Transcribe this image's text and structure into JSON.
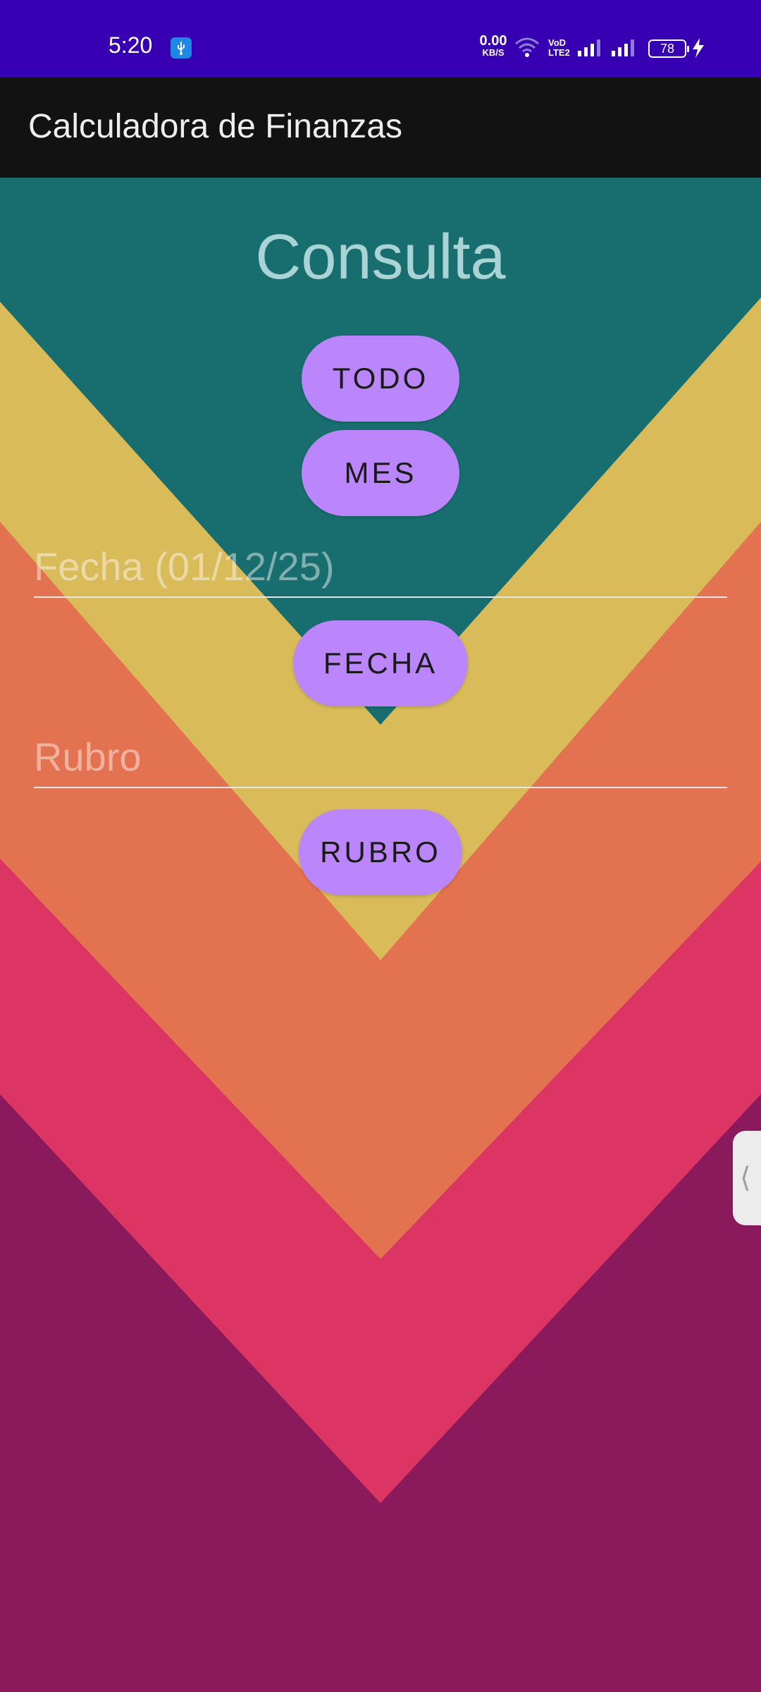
{
  "status_bar": {
    "time": "5:20",
    "net_speed_value": "0.00",
    "net_speed_unit": "KB/S",
    "volte_top": "VoD",
    "volte_bottom": "LTE2",
    "battery_level": "78"
  },
  "app_bar": {
    "title": "Calculadora de Finanzas"
  },
  "main": {
    "heading": "Consulta",
    "buttons": {
      "todo": "TODO",
      "mes": "MES",
      "fecha": "FECHA",
      "rubro": "RUBRO"
    },
    "fecha_field": {
      "value": "",
      "placeholder": "Fecha (01/12/25)"
    },
    "rubro_field": {
      "value": "",
      "placeholder": "Rubro"
    }
  },
  "edge_handle": {
    "glyph": "⟨"
  },
  "colors": {
    "status_bar": "#3700b3",
    "app_bar": "#121212",
    "teal": "#186e6f",
    "yellow": "#d9bb5a",
    "orange": "#e37251",
    "pink": "#dc3563",
    "plum": "#8b1a5c",
    "button": "#bb86fc"
  },
  "icons": [
    "usb-icon",
    "wifi-icon",
    "signal-icon",
    "battery-icon",
    "charging-bolt-icon",
    "chevron-left-icon"
  ]
}
